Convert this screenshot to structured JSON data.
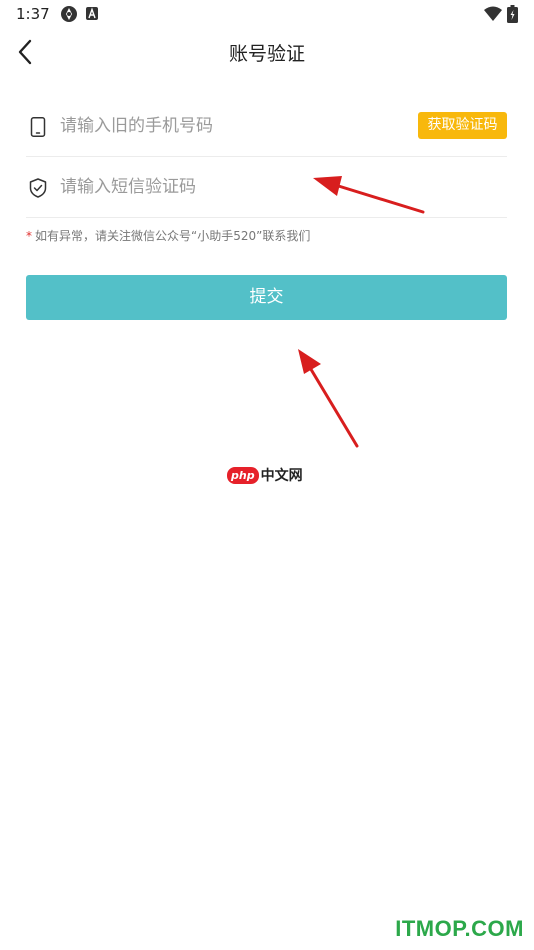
{
  "status_bar": {
    "time": "1:37",
    "icons": [
      "sync-icon",
      "a-icon",
      "wifi-icon",
      "battery-icon"
    ]
  },
  "header": {
    "title": "账号验证",
    "back_icon": "chevron-left-icon"
  },
  "form": {
    "phone": {
      "placeholder": "请输入旧的手机号码",
      "value": "",
      "icon": "phone-icon"
    },
    "get_code_label": "获取验证码",
    "code": {
      "placeholder": "请输入短信验证码",
      "value": "",
      "icon": "shield-check-icon"
    },
    "notice_star": "*",
    "notice_text": "如有异常，请关注微信公众号“小助手520”联系我们",
    "submit_label": "提交"
  },
  "watermarks": {
    "php_logo": "php",
    "php_text": "中文网",
    "itmop": "ITMOP.COM"
  },
  "colors": {
    "get_code_bg": "#f8b80c",
    "submit_bg": "#53c0c8",
    "notice_star": "#e0312f",
    "arrow": "#d81e1e",
    "itmop": "#2ca84a"
  }
}
